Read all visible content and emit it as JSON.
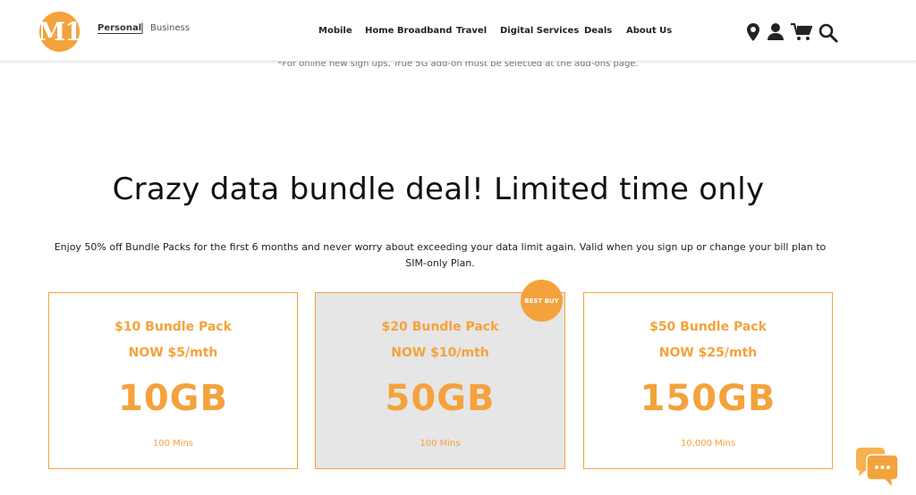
{
  "header": {
    "logo_text": "M1",
    "segments": {
      "personal": "Personal",
      "divider": "|",
      "business": "Business"
    },
    "nav": [
      "Mobile",
      "Home Broadband",
      "Travel",
      "Digital Services",
      "Deals",
      "About Us"
    ],
    "icons": [
      "location-pin-icon",
      "user-icon",
      "cart-icon",
      "search-icon"
    ]
  },
  "note": "*For online new sign ups, True 5G add-on must be selected at the add-ons page.",
  "headline": "Crazy data bundle deal! Limited time only",
  "description": "Enjoy 50% off Bundle Packs for the first 6 months and never worry about exceeding your data limit again. Valid when you sign up or change your bill plan to SIM-only Plan.",
  "plans": [
    {
      "name": "$10 Bundle Pack",
      "price": "NOW $5/mth",
      "data": "10GB",
      "mins": "100 Mins"
    },
    {
      "name": "$20 Bundle Pack",
      "price": "NOW $10/mth",
      "data": "50GB",
      "mins": "100 Mins",
      "badge": "BEST BUY"
    },
    {
      "name": "$50 Bundle Pack",
      "price": "NOW $25/mth",
      "data": "150GB",
      "mins": "10,000 Mins"
    }
  ],
  "colors": {
    "accent": "#f4a23c",
    "highlight_card_bg": "#e6e6e6"
  },
  "chat_icon": "chat-bubbles-icon"
}
